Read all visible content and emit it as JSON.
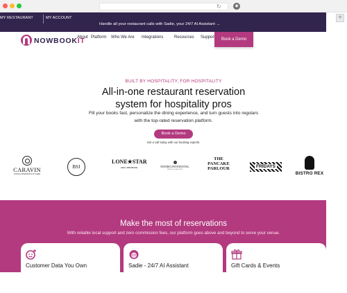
{
  "browser": {
    "reload_glyph": "↻",
    "shield_glyph": "◉",
    "newtab_glyph": "+"
  },
  "topbar": {
    "left_links": [
      "MY RESTAURANT",
      "MY ACCOUNT"
    ],
    "announcement": "Handle all your restaurant calls with Sadie, your 24/7 AI Assistant →"
  },
  "nav": {
    "brand_prefix": "NOWBOOK",
    "brand_suffix": "IT",
    "items": [
      "About",
      "Platform",
      "Who We Are",
      "Integrations",
      "Resources",
      "Support"
    ],
    "cta": "Book a Demo"
  },
  "hero": {
    "eyebrow": "BUILT BY HOSPITALITY, FOR HOSPITALITY",
    "headline_line1": "All-in-one restaurant reservation",
    "headline_line2": "system for hospitality pros",
    "sub_line1": "Fill your books fast, personalize the dining experience, and turn guests into regulars",
    "sub_line2": "with the top-rated reservation platform.",
    "cta": "Book a Demo",
    "cta_note": "Get a call today with our booking experts."
  },
  "logos": {
    "caravin": "CARAVIN",
    "caravin_sub": "CASUAL WINE BAR & KITCHEN",
    "bsj": "BSJ",
    "lonestar_line1": "LONE★STAR",
    "lonestar_sub": "GRILL BRISBANE",
    "intercontinental": "INTERCONTINENTAL",
    "intercontinental_sub": "HOTELS & RESORTS",
    "pancake_line1": "THE",
    "pancake_line2": "PANCAKE",
    "pancake_line3": "PARLOUR",
    "fridays": "FRIDAYS",
    "bistro": "BISTRO REX"
  },
  "features": {
    "title": "Make the most of reservations",
    "subtitle": "With reliable local support and zero commission fees, our platform goes above and beyond to serve your venue.",
    "cards": [
      {
        "title": "Customer Data You Own",
        "icon": "smiley-icon"
      },
      {
        "title": "Sadie - 24/7 AI Assistant",
        "icon": "assistant-face-icon"
      },
      {
        "title": "Gift Cards & Events",
        "icon": "gift-icon"
      }
    ]
  },
  "colors": {
    "brand_purple": "#31244d",
    "brand_magenta": "#b33a7f"
  }
}
